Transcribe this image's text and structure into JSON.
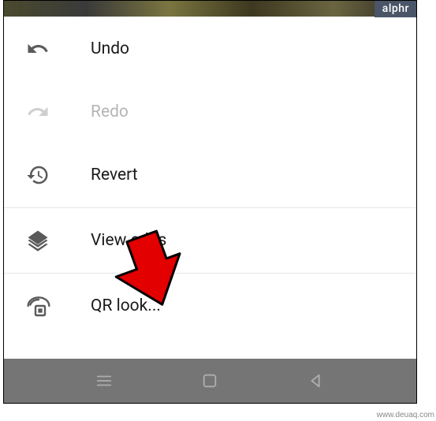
{
  "badge": {
    "label": "alphr"
  },
  "menu": {
    "undo": {
      "label": "Undo"
    },
    "redo": {
      "label": "Redo",
      "enabled": false
    },
    "revert": {
      "label": "Revert"
    },
    "viewEdits": {
      "label": "View edits"
    },
    "qrLook": {
      "label": "QR look..."
    }
  },
  "watermark": "www.deuaq.com"
}
